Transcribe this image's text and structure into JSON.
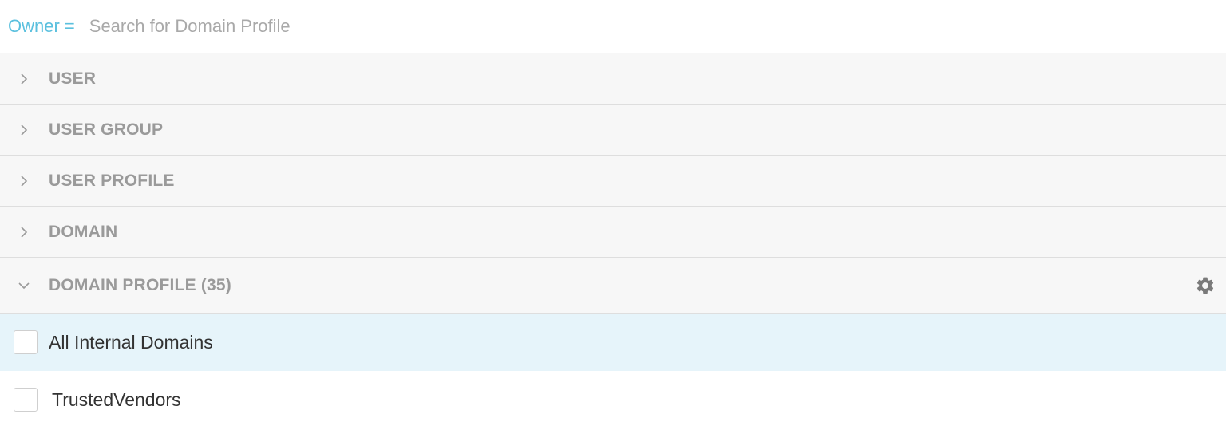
{
  "search": {
    "filter_label": "Owner =",
    "placeholder": "Search for Domain Profile",
    "value": ""
  },
  "sections": [
    {
      "label": "USER",
      "expanded": false,
      "icon": "chevron-right-icon"
    },
    {
      "label": "USER GROUP",
      "expanded": false,
      "icon": "chevron-right-icon"
    },
    {
      "label": "USER PROFILE",
      "expanded": false,
      "icon": "chevron-right-icon"
    },
    {
      "label": "DOMAIN",
      "expanded": false,
      "icon": "chevron-right-icon"
    },
    {
      "label": "DOMAIN PROFILE (35)",
      "expanded": true,
      "icon": "chevron-down-icon",
      "action_icon": "gear-icon"
    }
  ],
  "items": [
    {
      "label": "All Internal Domains",
      "checked": false,
      "highlighted": true
    },
    {
      "label": "TrustedVendors",
      "checked": false,
      "highlighted": false
    }
  ],
  "colors": {
    "accent": "#5bc0de",
    "section_bg": "#f7f7f7",
    "highlight_bg": "#e6f4fa",
    "section_text": "#9a9a9a"
  }
}
